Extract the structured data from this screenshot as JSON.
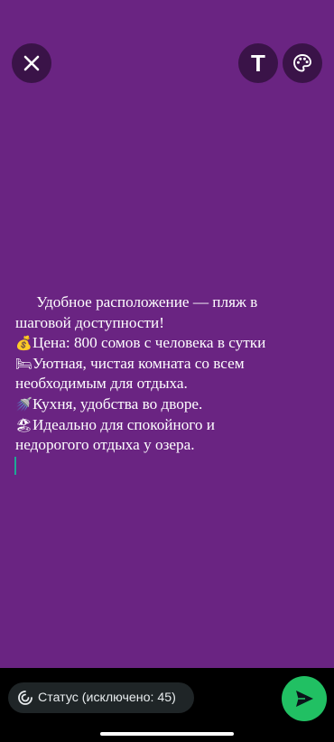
{
  "colors": {
    "background": "#6a2482",
    "toolbar_button": "#3a1348",
    "send_button": "#21c063",
    "caret": "#1fa896"
  },
  "toolbar": {
    "close_icon": "close-icon",
    "text_tool_label": "T",
    "palette_icon": "palette-icon"
  },
  "status": {
    "lines": [
      {
        "emoji": "",
        "text": " Удобное расположение — пляж в"
      },
      {
        "emoji": "",
        "text": "шаговой доступности!"
      },
      {
        "emoji": "💰",
        "text": "Цена: 800 сомов с человека в сутки"
      },
      {
        "emoji": "🛏",
        "text": "Уютная, чистая комната со всем"
      },
      {
        "emoji": "",
        "text": "необходимым для отдыха."
      },
      {
        "emoji": "🚿",
        "text": "Кухня, удобства во дворе."
      },
      {
        "emoji": "🏖",
        "text": "Идеально для спокойного и"
      },
      {
        "emoji": "",
        "text": "недорогого отдыха у озера."
      }
    ]
  },
  "footer": {
    "privacy_label": "Статус (исключено: 45)",
    "send_icon": "send-icon"
  }
}
